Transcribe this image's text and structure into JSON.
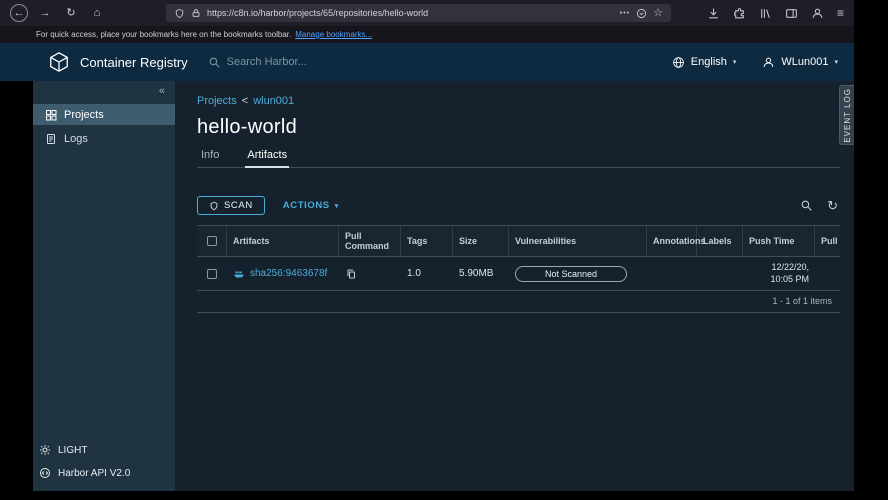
{
  "icons": {
    "back": "←",
    "forward": "→",
    "reload": "↻",
    "home": "⌂",
    "page_actions": "•••",
    "bookmark_star": "☆",
    "menu": "≡",
    "collapse": "«",
    "refresh": "↻",
    "caret": "▾"
  },
  "browser": {
    "url": "https://c8n.io/harbor/projects/65/repositories/hello-world",
    "bookmarks_notice": "For quick access, place your bookmarks here on the bookmarks toolbar.",
    "manage_bookmarks": "Manage bookmarks..."
  },
  "header": {
    "brand": "Container Registry",
    "search_placeholder": "Search Harbor...",
    "language": "English",
    "user": "WLun001"
  },
  "sidebar": {
    "items": [
      {
        "label": "Projects"
      },
      {
        "label": "Logs"
      }
    ],
    "theme": "LIGHT",
    "api": "Harbor API V2.0"
  },
  "page": {
    "breadcrumb": {
      "root": "Projects",
      "separator": "<",
      "current": "wlun001"
    },
    "title": "hello-world",
    "tabs": [
      {
        "label": "Info"
      },
      {
        "label": "Artifacts"
      }
    ]
  },
  "toolbar": {
    "scan": "SCAN",
    "actions": "ACTIONS"
  },
  "table": {
    "columns": [
      "Artifacts",
      "Pull Command",
      "Tags",
      "Size",
      "Vulnerabilities",
      "Annotations",
      "Labels",
      "Push Time",
      "Pull"
    ],
    "row": {
      "artifact": "sha256:9463678f",
      "tags": "1.0",
      "size": "5.90MB",
      "vulnerabilities": "Not Scanned",
      "push_time": "12/22/20, 10:05 PM"
    },
    "pagination": "1 - 1 of 1 items"
  },
  "event_log": "EVENT LOG",
  "colors": {
    "accent": "#4aaed9",
    "header_bg": "#0d2a40",
    "content_bg": "#15222d",
    "sidebar_bg": "#1f3440",
    "sidebar_selected": "#3e5c6e"
  }
}
